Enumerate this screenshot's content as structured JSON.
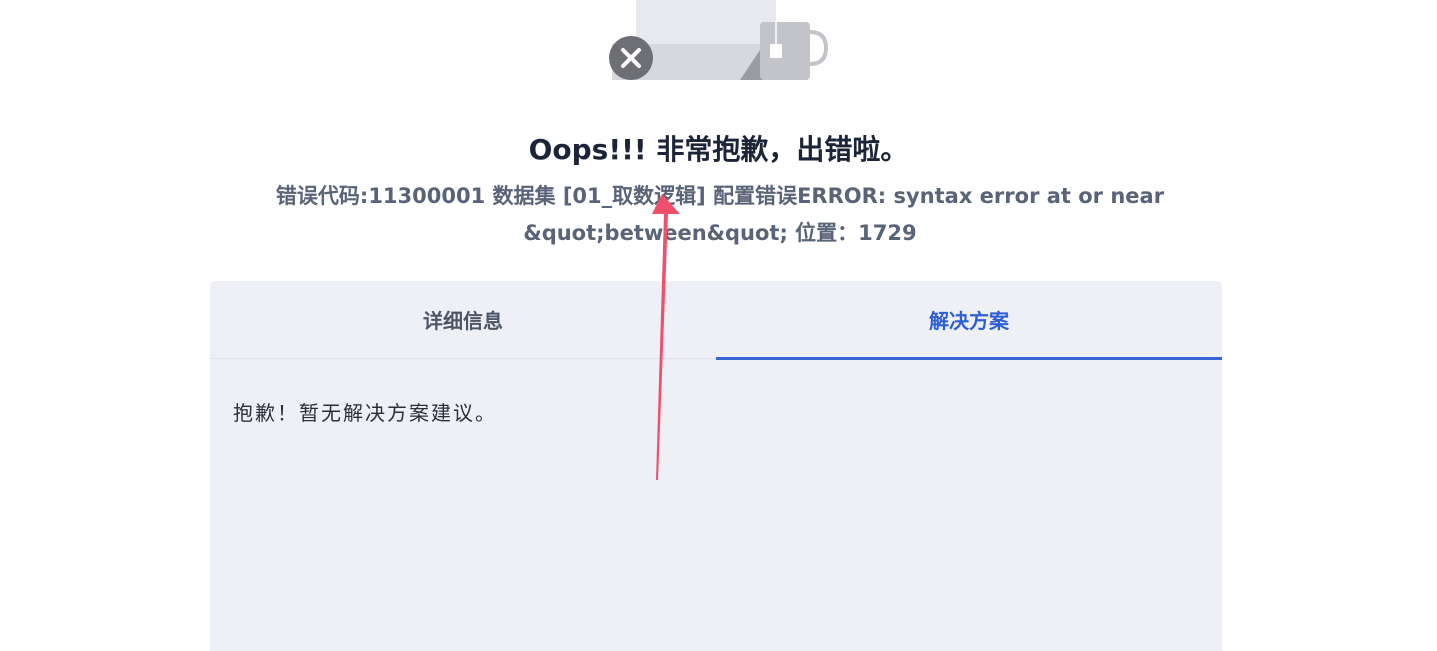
{
  "header": {
    "title": "Oops!!! 非常抱歉，出错啦。",
    "error_line1": "错误代码:11300001 数据集 [01_取数逻辑] 配置错误ERROR: syntax error at or near",
    "error_line2": "&quot;between&quot; 位置：1729"
  },
  "tabs": [
    {
      "label": "详细信息",
      "active": false
    },
    {
      "label": "解决方案",
      "active": true
    }
  ],
  "content": {
    "text": "抱歉！暂无解决方案建议。"
  },
  "colors": {
    "accent": "#3b63d9",
    "annotation_arrow": "#f0506e",
    "panel_bg": "#eef0f5"
  }
}
